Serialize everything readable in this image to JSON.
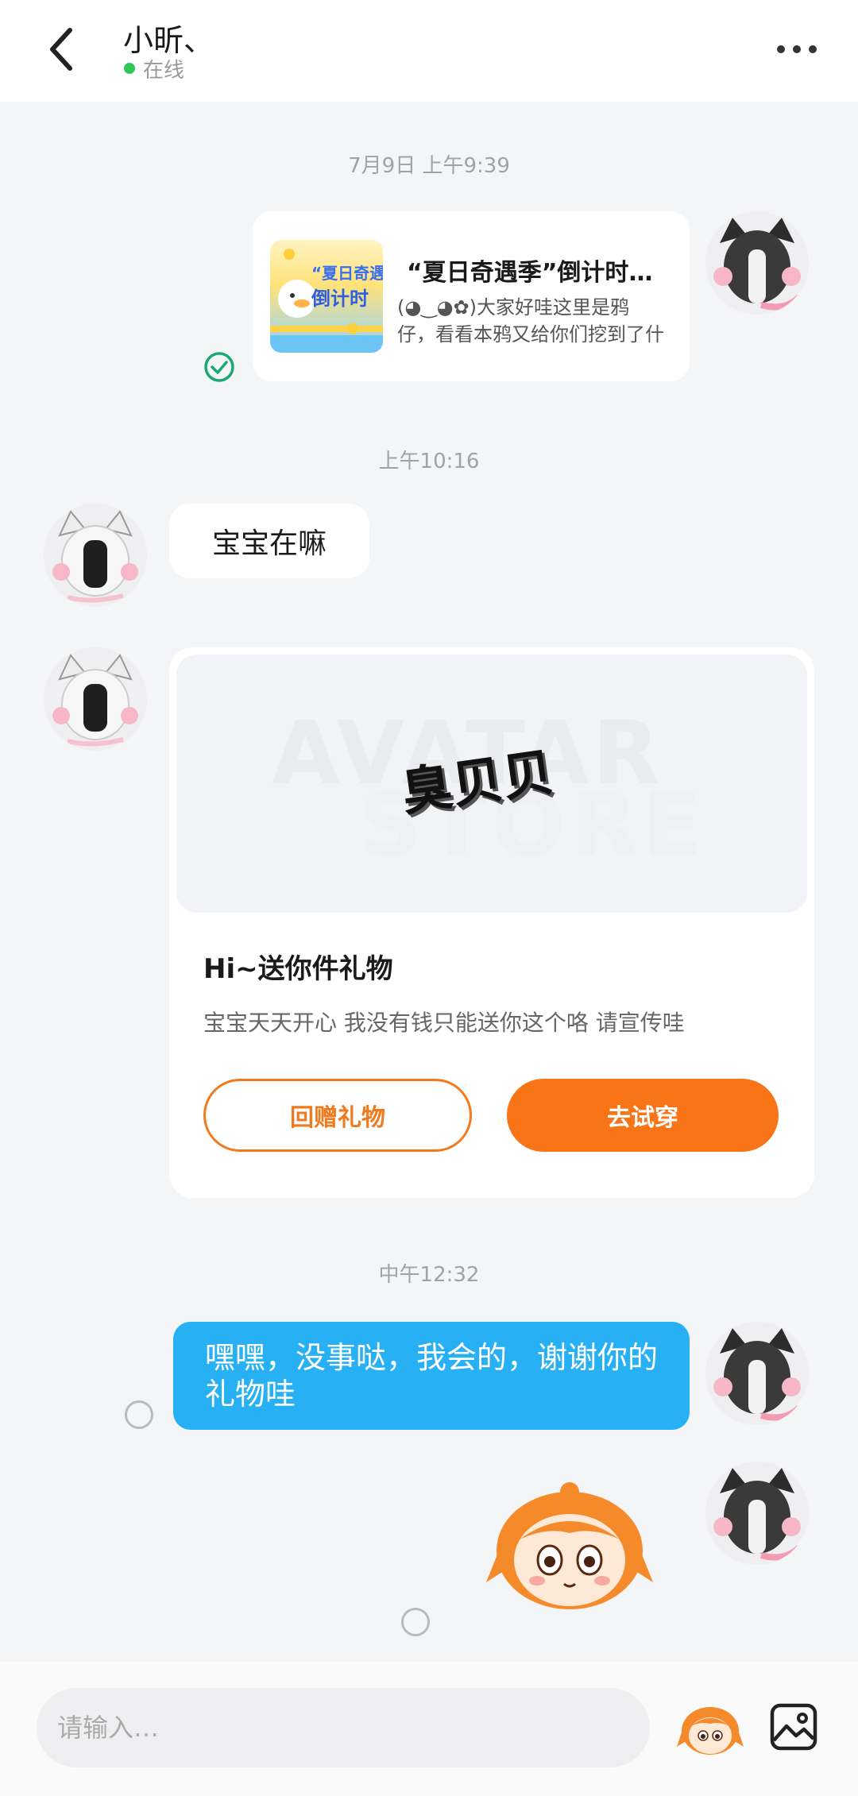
{
  "header": {
    "title": "小昕、",
    "status": "在线"
  },
  "messages": {
    "ts1": "7月9日 上午9:39",
    "card": {
      "title": "“夏日奇遇季”倒计时开启",
      "description": "(◕‿◕✿)大家好哇这里是鸦仔，看看本鸦又给你们挖到了什么",
      "thumb_line1": "“夏日奇遇",
      "thumb_line2": "倒计时"
    },
    "ts2": "上午10:16",
    "left_text": "宝宝在嘛",
    "gift": {
      "watermark_1": "AVATAR",
      "watermark_2": "STORE",
      "sticker_text": "臭贝贝",
      "title": "Hi~送你件礼物",
      "description": "宝宝天天开心 我没有钱只能送你这个咯 请宣传哇",
      "return_button": "回赠礼物",
      "try_button": "去试穿"
    },
    "ts3": "中午12:32",
    "right_text": "嘿嘿，没事哒，我会的，谢谢你的礼物哇"
  },
  "input": {
    "placeholder": "请输入…"
  },
  "colors": {
    "accent_orange": "#f97416",
    "bubble_blue": "#27b0f4",
    "online_green": "#33c759",
    "check_green": "#19a974"
  },
  "icons": [
    "back-arrow-icon",
    "more-dots-icon",
    "check-circle-icon",
    "pending-circle-icon",
    "mascot-sticker-icon",
    "image-icon"
  ]
}
